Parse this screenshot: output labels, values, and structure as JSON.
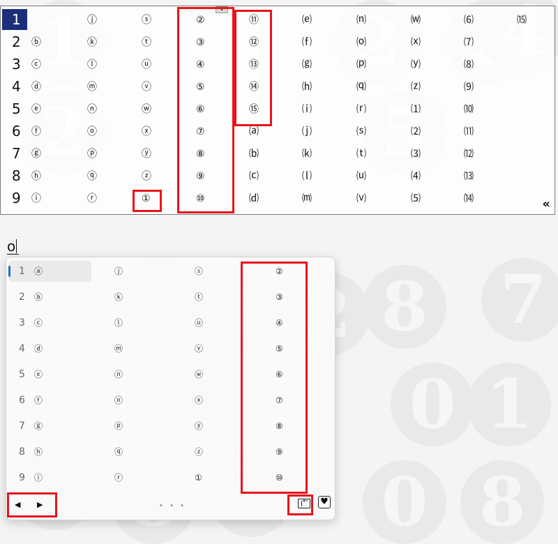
{
  "background_numerals": [
    "1",
    "2",
    "2",
    "4",
    "2",
    "5",
    "7",
    "3",
    "2",
    "8",
    "0",
    "7",
    "3",
    "1",
    "3",
    "8",
    "2",
    "0",
    "8"
  ],
  "legacy_panel": {
    "indices": [
      "1",
      "2",
      "3",
      "4",
      "5",
      "6",
      "7",
      "8",
      "9"
    ],
    "columns": [
      [
        "ⓐ",
        "ⓑ",
        "ⓒ",
        "ⓓ",
        "ⓔ",
        "ⓕ",
        "ⓖ",
        "ⓗ",
        "ⓘ"
      ],
      [
        "ⓙ",
        "ⓚ",
        "ⓛ",
        "ⓜ",
        "ⓝ",
        "ⓞ",
        "ⓟ",
        "ⓠ",
        "ⓡ"
      ],
      [
        "ⓢ",
        "ⓣ",
        "ⓤ",
        "ⓥ",
        "ⓦ",
        "ⓧ",
        "ⓨ",
        "ⓩ",
        "①"
      ],
      [
        "②",
        "③",
        "④",
        "⑤",
        "⑥",
        "⑦",
        "⑧",
        "⑨",
        "⑩"
      ],
      [
        "⑪",
        "⑫",
        "⑬",
        "⑭",
        "⑮",
        "⒜",
        "⒝",
        "⒞",
        "⒟"
      ],
      [
        "⒠",
        "⒡",
        "⒢",
        "⒣",
        "⒤",
        "⒥",
        "⒦",
        "⒧",
        "⒨"
      ],
      [
        "⒩",
        "⒪",
        "⒫",
        "⒬",
        "⒭",
        "⒮",
        "⒯",
        "⒰",
        "⒱"
      ],
      [
        "⒲",
        "⒳",
        "⒴",
        "⒵",
        "⑴",
        "⑵",
        "⑶",
        "⑷",
        "⑸"
      ],
      [
        "⑹",
        "⑺",
        "⑻",
        "⑼",
        "⑽",
        "⑾",
        "⑿",
        "⒀",
        "⒁"
      ],
      [
        "⒂",
        "",
        "",
        "",
        "",
        "",
        "",
        "",
        ""
      ]
    ],
    "selected_index": "1",
    "resize_handle": "▾",
    "expand_label": "«"
  },
  "composition": {
    "text": "o"
  },
  "modern_panel": {
    "indices": [
      "1",
      "2",
      "3",
      "4",
      "5",
      "6",
      "7",
      "8",
      "9"
    ],
    "columns": [
      [
        "ⓐ",
        "ⓑ",
        "ⓒ",
        "ⓓ",
        "ⓔ",
        "ⓕ",
        "ⓖ",
        "ⓗ",
        "ⓘ"
      ],
      [
        "ⓙ",
        "ⓚ",
        "ⓛ",
        "ⓜ",
        "ⓝ",
        "ⓞ",
        "ⓟ",
        "ⓠ",
        "ⓡ"
      ],
      [
        "ⓢ",
        "ⓣ",
        "ⓤ",
        "ⓥ",
        "ⓦ",
        "ⓧ",
        "ⓨ",
        "ⓩ",
        "①"
      ],
      [
        "②",
        "③",
        "④",
        "⑤",
        "⑥",
        "⑦",
        "⑧",
        "⑨",
        "⑩"
      ]
    ],
    "prev_label": "◀",
    "next_label": "▶",
    "page_dots": "• • •",
    "favorite_label": "♥",
    "icons": {
      "pin": "pin-to-side-icon",
      "favorite": "favorite-heart-icon"
    }
  },
  "colors": {
    "selection": "#1c2f7a",
    "highlight": "#e8141b",
    "accent": "#1f6fd1"
  }
}
